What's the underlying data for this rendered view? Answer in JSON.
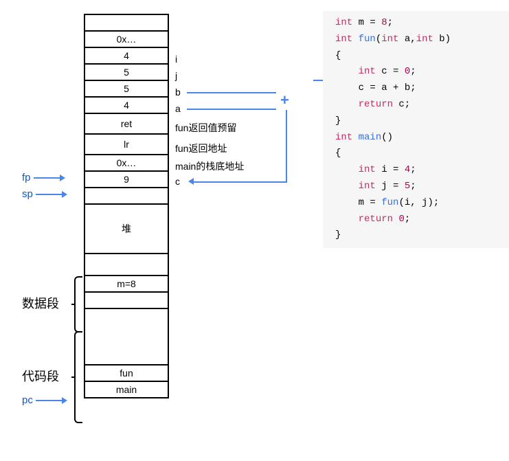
{
  "memory": {
    "cells": [
      {
        "value": "",
        "label": ""
      },
      {
        "value": "0x…",
        "label": ""
      },
      {
        "value": "4",
        "label": "i"
      },
      {
        "value": "5",
        "label": "j"
      },
      {
        "value": "5",
        "label": "b"
      },
      {
        "value": "4",
        "label": "a"
      },
      {
        "value": "ret",
        "label": "fun返回值预留"
      },
      {
        "value": "lr",
        "label": "fun返回地址"
      },
      {
        "value": "0x…",
        "label": "main的栈底地址"
      },
      {
        "value": "9",
        "label": "c"
      }
    ],
    "heap_label": "堆",
    "data_cell": "m=8",
    "code_cells": [
      "fun",
      "main"
    ]
  },
  "pointers": {
    "fp": "fp",
    "sp": "sp",
    "pc": "pc"
  },
  "segments": {
    "data": "数据段",
    "code": "代码段"
  },
  "plus": "+",
  "code": {
    "l1_int": "int",
    "l1_rest": " m = ",
    "l1_num": "8",
    "l1_end": ";",
    "l2_int": "int",
    "l2_sp": " ",
    "l2_fn": "fun",
    "l2_sig1": "(",
    "l2_int2": "int",
    "l2_sig2": " a,",
    "l2_int3": "int",
    "l2_sig3": " b)",
    "l3": "{",
    "l4_int": "int",
    "l4_rest": " c = ",
    "l4_num": "0",
    "l4_end": ";",
    "l5": "c = a + b;",
    "l6_ret": "return",
    "l6_rest": " c;",
    "l7": "}",
    "l8_int": "int",
    "l8_sp": " ",
    "l8_fn": "main",
    "l8_sig": "()",
    "l9": "{",
    "l10_int": "int",
    "l10_rest": " i = ",
    "l10_num": "4",
    "l10_end": ";",
    "l11_int": "int",
    "l11_rest": " j = ",
    "l11_num": "5",
    "l11_end": ";",
    "l12_a": "m = ",
    "l12_fn": "fun",
    "l12_b": "(i, j);",
    "l13_ret": "return",
    "l13_sp": " ",
    "l13_num": "0",
    "l13_end": ";",
    "l14": "}"
  }
}
